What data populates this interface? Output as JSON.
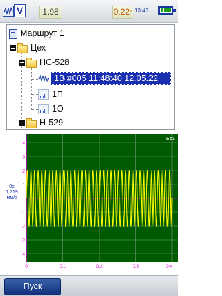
{
  "status_bar": {
    "mode_letter": "V",
    "left_value": "1.98",
    "right_value": "0.22",
    "right_value_unit": "°",
    "time": "13:43",
    "battery_level": 1.0
  },
  "tree": {
    "root": {
      "label": "Маршрут 1",
      "icon": "route-icon"
    },
    "nodes": [
      {
        "label": "Цех",
        "icon": "folder-icon"
      },
      {
        "label": "НС-528",
        "icon": "folder-icon"
      },
      {
        "label": "1В #005 11:48:40 12.05.22",
        "icon": "waveform-icon",
        "selected": true
      },
      {
        "label": "1П",
        "icon": "spectrum-icon"
      },
      {
        "label": "1О",
        "icon": "spectrum-icon"
      },
      {
        "label": "Н-529",
        "icon": "folder-icon"
      }
    ]
  },
  "plot": {
    "channel_label": "Вх1",
    "y_readout": "0с",
    "y_value": "1.719",
    "y_unit": "мм/с",
    "background_color": "#005a00",
    "trace_color": "#ffff00",
    "grid_color": "#7a9a7a",
    "tick_color": "#e000e0"
  },
  "chart_data": {
    "type": "line",
    "title": "",
    "xlabel": "",
    "ylabel": "",
    "x_ticks": [
      "0",
      "0.1",
      "0.2",
      "0.3",
      "0.4"
    ],
    "y_ticks": [
      "4",
      "3",
      "2",
      "1",
      "-1",
      "-2",
      "-3",
      "-4"
    ],
    "xlim": [
      0,
      0.4
    ],
    "ylim": [
      -4.6,
      4.6
    ],
    "series": [
      {
        "amplitude": 2.0,
        "frequency_hz": 100,
        "x_start": 0,
        "x_end": 0.4
      }
    ]
  },
  "toolbar": {
    "start_label": "Пуск"
  }
}
